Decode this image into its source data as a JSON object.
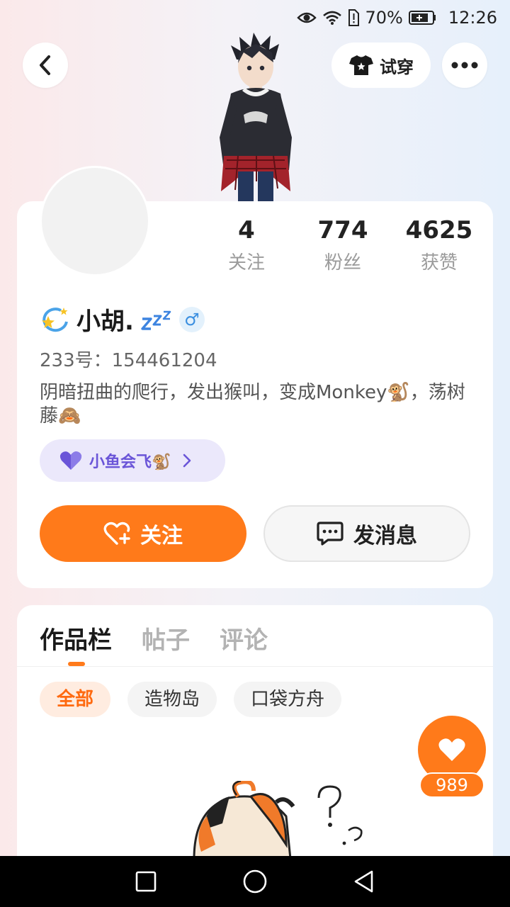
{
  "status_bar": {
    "battery": "70%",
    "time": "12:26"
  },
  "header": {
    "tryon_label": "试穿"
  },
  "profile": {
    "stats": [
      {
        "num": "4",
        "label": "关注"
      },
      {
        "num": "774",
        "label": "粉丝"
      },
      {
        "num": "4625",
        "label": "获赞"
      }
    ],
    "username": "小胡.",
    "gender": "♂",
    "uid": "233号：154461204",
    "bio": "阴暗扭曲的爬行，发出猴叫，变成Monkey🐒，荡树藤🙈",
    "guild": "小鱼会飞🐒",
    "follow_label": "关注",
    "message_label": "发消息"
  },
  "content": {
    "tabs": [
      "作品栏",
      "帖子",
      "评论"
    ],
    "chips": [
      "全部",
      "造物岛",
      "口袋方舟"
    ]
  },
  "like": {
    "count": "989"
  },
  "colors": {
    "accent": "#ff7a1a",
    "guild": "#6a55d8"
  }
}
